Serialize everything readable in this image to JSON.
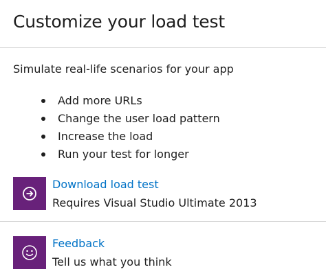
{
  "header": {
    "title": "Customize your load test"
  },
  "intro": {
    "subtitle": "Simulate real-life scenarios for your app",
    "bullets": [
      "Add more URLs",
      "Change the user load pattern",
      "Increase the load",
      "Run your test for longer"
    ]
  },
  "actions": {
    "download": {
      "icon": "arrow-right-circle-icon",
      "link_label": "Download load test",
      "description": "Requires Visual Studio Ultimate 2013"
    },
    "feedback": {
      "icon": "smiley-icon",
      "link_label": "Feedback",
      "description": "Tell us what you think"
    }
  },
  "colors": {
    "tile_background": "#68217a",
    "link": "#0072c6",
    "divider": "#d4d4d4"
  }
}
